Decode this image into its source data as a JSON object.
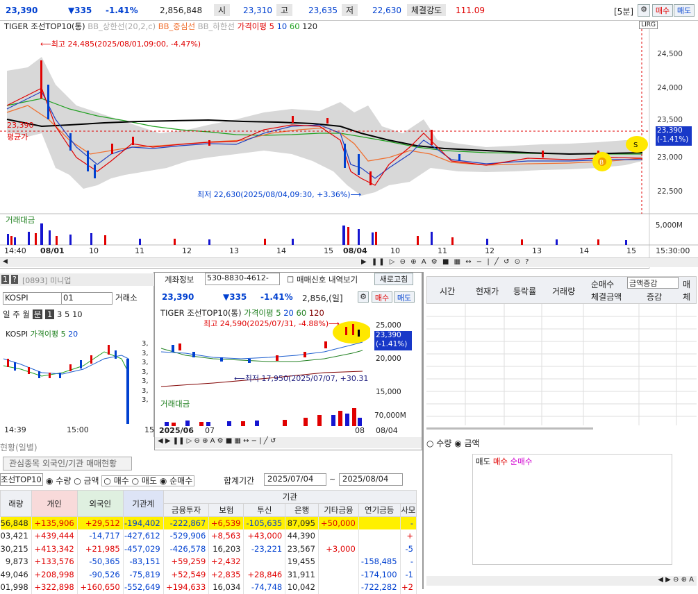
{
  "topbar": {
    "price": "23,390",
    "change": "▼335",
    "pct": "-1.41%",
    "volume": "2,856,848",
    "open_label": "시",
    "open": "23,310",
    "high_label": "고",
    "high": "23,635",
    "low_label": "저",
    "low": "22,630",
    "strength_label": "체결강도",
    "strength": "111.09",
    "interval": "[5분]",
    "buy": "매수",
    "sell": "매도"
  },
  "main_chart": {
    "legend_name": "TIGER 조선TOP10(통)",
    "legend_upper": "BB_상한선(20,2,c)",
    "legend_mid": "BB_중심선",
    "legend_lower": "BB_하한선",
    "legend_ma": "가격이평 5",
    "ma10": "10",
    "ma60": "60",
    "ma120": "120",
    "high_note": "⟵최고 24,485(2025/08/01,09:00, -4.47%)",
    "low_note": "최저 22,630(2025/08/04,09:30, +3.36%)⟶",
    "avg_price": "23,390",
    "avg_label": "평균가",
    "cur_price": "23,390",
    "cur_pct": "(-1.41%)",
    "vol_label": "거래대금",
    "vol_axis": "5,000M",
    "y_ticks": [
      "24,500",
      "24,000",
      "23,500",
      "23,000",
      "22,500"
    ],
    "x_ticks": [
      "14:40",
      "08/01",
      "10",
      "11",
      "12",
      "13",
      "14",
      "15",
      "08/04",
      "10",
      "11",
      "12",
      "13",
      "14",
      "15",
      "15:30:00"
    ],
    "toolbar_icons": "LIRG"
  },
  "mini": {
    "header": "[0893] 미니업",
    "market": "KOSPI",
    "code": "01",
    "exchange": "거래소",
    "periods": [
      "일",
      "주",
      "월",
      "분",
      "1",
      "3",
      "5",
      "10"
    ],
    "legend": "KOSPI",
    "legend_ma": "가격이평 5",
    "legend_ma2": "20",
    "x_ticks": [
      "14:39",
      "15:00",
      "15"
    ],
    "y_ticks": [
      "3,",
      "3,",
      "3,",
      "3,",
      "3,",
      "3,",
      "3,"
    ]
  },
  "center": {
    "acct_label": "계좌정보",
    "acct": "530-8830-4612-",
    "signal": "매매신호 내역보기",
    "refresh": "새로고침",
    "price": "23,390",
    "change": "▼335",
    "pct": "-1.41%",
    "volume": "2,856,(일]",
    "buy": "매수",
    "sell": "매도",
    "legend_name": "TIGER 조선TOP10(통)",
    "legend_ma": "가격이평 5",
    "ma20": "20",
    "ma60": "60",
    "ma120": "120",
    "high_note": "최고 24,590(2025/07/31, -4.88%)⟶",
    "low_note": "⟵최저 17,950(2025/07/07, +30.31",
    "y_ticks": [
      "25,000",
      "20,000",
      "15,000"
    ],
    "cur": "23,390",
    "cur_pct": "(-1.41%)",
    "vol_label": "거래대금",
    "vol_axis": "70,000M",
    "x_ticks": [
      "2025/06",
      "07",
      "08",
      "08/04"
    ]
  },
  "right": {
    "headers": [
      "시간",
      "현재가",
      "등락률",
      "거래량",
      "순매수",
      "금액증감",
      "매"
    ],
    "sub_headers": [
      "체결금액",
      "증감",
      "체"
    ],
    "radio_qty": "수량",
    "radio_amt": "금액",
    "legend_sell": "매도",
    "legend_buy": "매수",
    "legend_net": "순매수"
  },
  "bottom": {
    "section": "현황(일별)",
    "tab": "관심종목 외국인/기관 매매현황",
    "stock": "조선TOP10",
    "opt_qty": "수량",
    "opt_amt": "금액",
    "opt_buy": "매수",
    "opt_sell": "매도",
    "opt_net": "순매수",
    "period_label": "합계기간",
    "date_from": "2025/07/04",
    "date_to": "2025/08/04",
    "inst_label": "기관",
    "cols": [
      "래량",
      "개인",
      "외국인",
      "기관계",
      "금융투자",
      "보험",
      "투신",
      "은행",
      "기타금융",
      "연기금등",
      "사모"
    ],
    "rows": [
      [
        "56,848",
        "+135,906",
        "+29,512",
        "-194,402",
        "-222,867",
        "+6,539",
        "-105,635",
        "87,095",
        "+50,000",
        "",
        "-"
      ],
      [
        "03,421",
        "+439,444",
        "-14,717",
        "-427,612",
        "-529,906",
        "+8,563",
        "+43,000",
        "44,390",
        "",
        "",
        "+"
      ],
      [
        "30,215",
        "+413,342",
        "+21,985",
        "-457,029",
        "-426,578",
        "16,203",
        "-23,221",
        "23,567",
        "+3,000",
        "",
        "-5"
      ],
      [
        "9,873",
        "+133,576",
        "-50,365",
        "-83,151",
        "+59,259",
        "+2,432",
        "",
        "19,455",
        "",
        "-158,485",
        "-"
      ],
      [
        "49,046",
        "+208,998",
        "-90,526",
        "-75,819",
        "+52,549",
        "+2,835",
        "+28,846",
        "31,911",
        "",
        "-174,100",
        "-1"
      ],
      [
        "01,998",
        "+322,898",
        "+160,650",
        "-552,649",
        "+194,633",
        "16,034",
        "-74,748",
        "10,042",
        "",
        "-722,282",
        "+2"
      ]
    ]
  }
}
